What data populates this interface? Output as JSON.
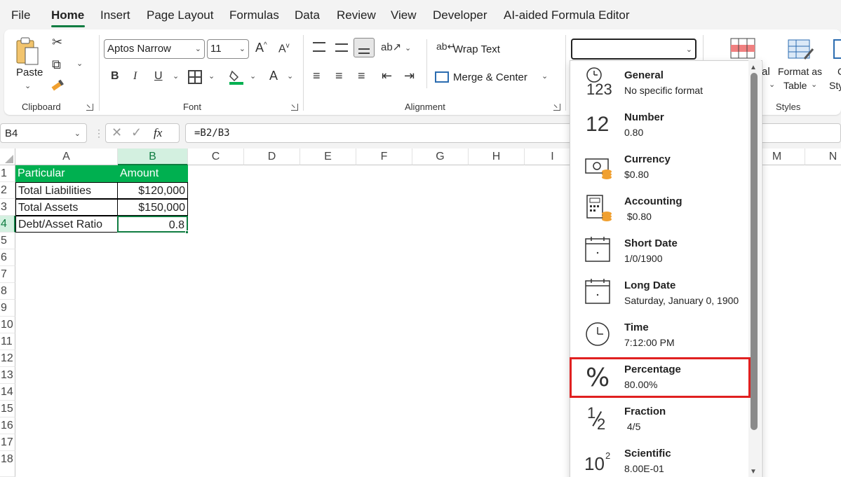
{
  "menu": {
    "tabs": [
      "File",
      "Home",
      "Insert",
      "Page Layout",
      "Formulas",
      "Data",
      "Review",
      "View",
      "Developer",
      "AI-aided Formula Editor"
    ],
    "active": "Home"
  },
  "ribbon": {
    "clipboard": {
      "paste_label": "Paste",
      "group_label": "Clipboard"
    },
    "font": {
      "font_name": "Aptos Narrow",
      "font_size": "11",
      "group_label": "Font",
      "bold": "B",
      "italic": "I",
      "underline": "U",
      "font_color_glyph": "A",
      "grow": "A",
      "shrink": "A"
    },
    "alignment": {
      "wrap_text": "Wrap Text",
      "merge_center": "Merge & Center",
      "group_label": "Alignment"
    },
    "styles": {
      "conditional_partial": "al",
      "format_as_table_line1": "Format as",
      "format_as_table_line2": "Table",
      "cell_styles_line1": "C",
      "cell_styles_line2": "Sty",
      "group_label": "Styles"
    },
    "number_format_value": ""
  },
  "formula_bar": {
    "name_box": "B4",
    "fx": "fx",
    "formula": "=B2/B3"
  },
  "grid": {
    "columns": [
      "A",
      "B",
      "C",
      "D",
      "E",
      "F",
      "G",
      "H",
      "I",
      "M",
      "N"
    ],
    "rows": [
      "1",
      "2",
      "3",
      "4",
      "5",
      "6",
      "7",
      "8",
      "9",
      "10",
      "11",
      "12",
      "13",
      "14",
      "15",
      "16",
      "17",
      "18"
    ],
    "cells": {
      "A1": "Particular",
      "B1": "Amount",
      "A2": "Total Liabilities",
      "B2": "$120,000",
      "A3": "Total Assets",
      "B3": "$150,000",
      "A4": "Debt/Asset Ratio",
      "B4": "0.8"
    },
    "header_fill_color": "#00b050",
    "selected_cell": "B4"
  },
  "number_format_dropdown": {
    "items": [
      {
        "name": "General",
        "sample": "No specific format",
        "icon": "clock-123-icon"
      },
      {
        "name": "Number",
        "sample": "0.80",
        "icon": "number-12-icon"
      },
      {
        "name": "Currency",
        "sample": "$0.80",
        "icon": "currency-icon"
      },
      {
        "name": "Accounting",
        "sample": " $0.80",
        "icon": "accounting-calculator-icon"
      },
      {
        "name": "Short Date",
        "sample": "1/0/1900",
        "icon": "calendar-icon"
      },
      {
        "name": "Long Date",
        "sample": "Saturday, January 0, 1900",
        "icon": "calendar-icon"
      },
      {
        "name": "Time",
        "sample": "7:12:00 PM",
        "icon": "clock-icon"
      },
      {
        "name": "Percentage",
        "sample": "80.00%",
        "icon": "percent-icon"
      },
      {
        "name": "Fraction",
        "sample": " 4/5",
        "icon": "fraction-icon"
      },
      {
        "name": "Scientific",
        "sample": "8.00E-01",
        "icon": "scientific-icon"
      }
    ],
    "highlighted": "Percentage",
    "highlight_color": "#e02020",
    "icon_glyphs": {
      "number": "12",
      "general_digits": "123",
      "percent": "%",
      "fraction_top": "1",
      "fraction_bottom": "2",
      "sci_base": "10",
      "sci_exp": "2"
    }
  }
}
